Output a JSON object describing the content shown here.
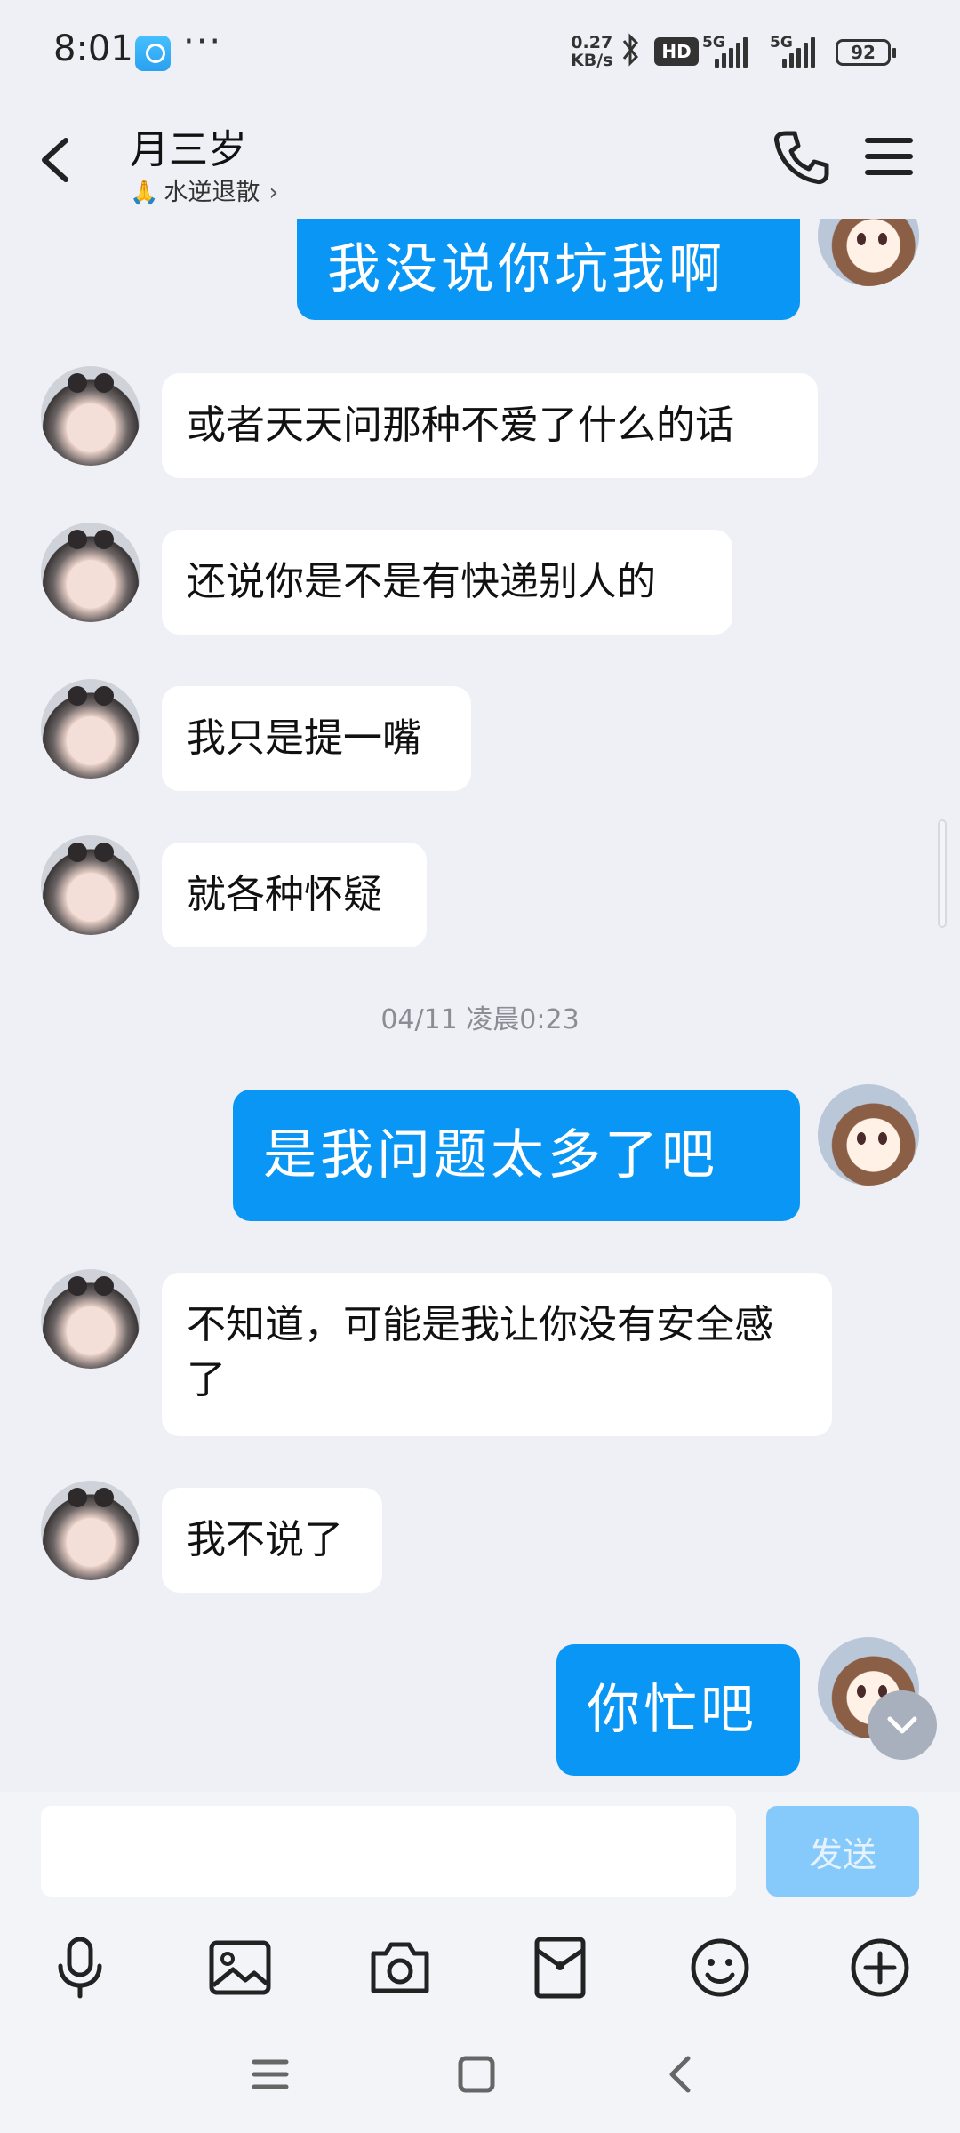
{
  "status_bar": {
    "time": "8:01",
    "overflow": "···",
    "net_speed_value": "0.27",
    "net_speed_unit": "KB/s",
    "hd_badge": "HD",
    "network1": "5G",
    "network2": "5G",
    "battery": "92",
    "icons": [
      "app-notification-icon",
      "bluetooth-icon",
      "signal-icon",
      "battery-icon"
    ]
  },
  "header": {
    "title": "月三岁",
    "subtitle_emoji": "🙏",
    "subtitle": "水逆退散",
    "subtitle_chevron": "›",
    "icons": [
      "back-icon",
      "phone-icon",
      "menu-icon"
    ]
  },
  "messages": [
    {
      "from": "me",
      "text": "我没说你坑我啊"
    },
    {
      "from": "them",
      "text": "或者天天问那种不爱了什么的话"
    },
    {
      "from": "them",
      "text": "还说你是不是有快递别人的"
    },
    {
      "from": "them",
      "text": "我只是提一嘴"
    },
    {
      "from": "them",
      "text": "就各种怀疑"
    },
    {
      "type": "time",
      "text": "04/11 凌晨0:23"
    },
    {
      "from": "me",
      "text": "是我问题太多了吧"
    },
    {
      "from": "them",
      "text": "不知道，可能是我让你没有安全感了"
    },
    {
      "from": "them",
      "text": "我不说了"
    },
    {
      "from": "me",
      "text": "你忙吧"
    }
  ],
  "composer": {
    "input_value": "",
    "send_label": "发送",
    "send_enabled": false
  },
  "toolbar": {
    "icons": [
      "microphone-icon",
      "image-icon",
      "camera-icon",
      "red-packet-icon",
      "emoji-icon",
      "plus-icon"
    ]
  },
  "system_nav": {
    "icons": [
      "recents-icon",
      "home-icon",
      "back-nav-icon"
    ]
  },
  "colors": {
    "my_bubble": "#0a96f4",
    "their_bubble": "#ffffff",
    "chat_background": "#eef0f5",
    "send_disabled": "#86c9fb"
  }
}
